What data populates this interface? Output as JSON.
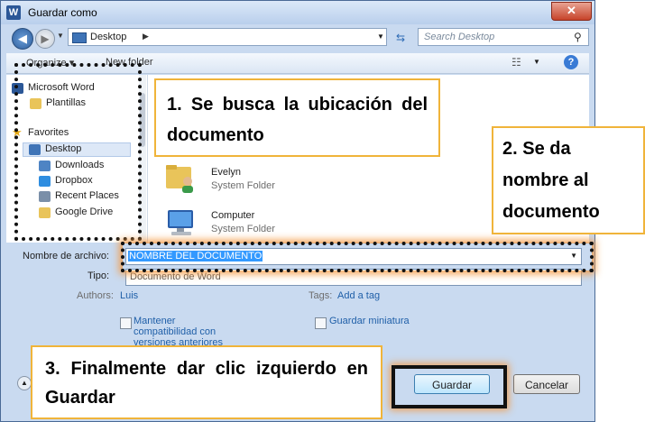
{
  "window": {
    "title": "Guardar como",
    "app_icon": "W",
    "close_symbol": "✕"
  },
  "nav": {
    "address": "Desktop",
    "search_placeholder": "Search Desktop"
  },
  "toolbar": {
    "organize": "Organize ▾",
    "new_folder": "New folder"
  },
  "nav_pane": {
    "items": [
      {
        "label": "Microsoft Word",
        "icon": "word-icon"
      },
      {
        "label": "Plantillas",
        "icon": "folder-icon"
      },
      {
        "label": "Favorites",
        "icon": "star-icon"
      },
      {
        "label": "Desktop",
        "icon": "desktop-icon",
        "selected": true
      },
      {
        "label": "Downloads",
        "icon": "downloads-icon"
      },
      {
        "label": "Dropbox",
        "icon": "dropbox-icon"
      },
      {
        "label": "Recent Places",
        "icon": "recent-places-icon"
      },
      {
        "label": "Google Drive",
        "icon": "google-drive-icon"
      }
    ]
  },
  "files": [
    {
      "name": "Evelyn",
      "type": "System Folder",
      "icon": "user-folder-icon"
    },
    {
      "name": "Computer",
      "type": "System Folder",
      "icon": "computer-icon"
    }
  ],
  "form": {
    "filename_label": "Nombre de archivo:",
    "filename_value": "NOMBRE DEL DOCUMENTO",
    "type_label": "Tipo:",
    "type_value": "Documento de Word",
    "authors_label": "Authors:",
    "authors_value": "Luis",
    "tags_label": "Tags:",
    "tags_value": "Add a tag",
    "keep_compat_label": "Mantener compatibilidad con versiones anteriores",
    "thumbnail_label": "Guardar miniatura"
  },
  "buttons": {
    "save": "Guardar",
    "cancel": "Cancelar"
  },
  "callouts": {
    "step1": "1. Se busca la ubicación del documento",
    "step2": "2. Se da nombre al documento",
    "step3": "3. Finalmente dar clic izquierdo en Guardar"
  },
  "colors": {
    "callout_border": "#f0b43a",
    "glow": "#f5963c",
    "selection": "#3399ff"
  }
}
